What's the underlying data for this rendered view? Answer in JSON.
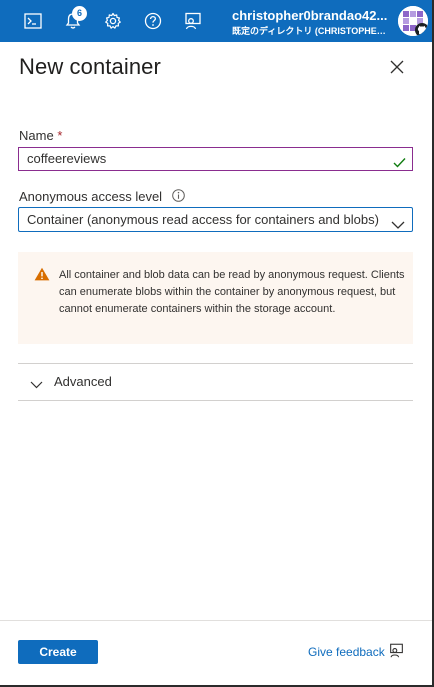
{
  "topbar": {
    "notification_count": "6",
    "account_name": "christopher0brandao42...",
    "directory": "既定のディレクトリ (CHRISTOPHER0..."
  },
  "panel": {
    "title": "New container",
    "name_label": "Name",
    "required_mark": "*",
    "name_value": "coffeereviews",
    "access_label": "Anonymous access level",
    "access_value": "Container (anonymous read access for containers and blobs)",
    "warning_text": "All container and blob data can be read by anonymous request. Clients can enumerate blobs within the container by anonymous request, but cannot enumerate containers within the storage account.",
    "advanced_label": "Advanced"
  },
  "footer": {
    "create_label": "Create",
    "feedback_label": "Give feedback"
  },
  "colors": {
    "topbar": "#0f6cbd",
    "primary": "#0f6cbd",
    "input_border_valid": "#8a2d8f",
    "success_check": "#107c10",
    "warning_icon": "#d86e00",
    "warning_bg": "#fdf6f0"
  },
  "icons": [
    "cloud-shell-icon",
    "bell-icon",
    "gear-icon",
    "help-icon",
    "feedback-icon",
    "avatar",
    "close-icon",
    "check-icon",
    "info-icon",
    "chevron-down-icon",
    "warning-icon",
    "chevron-down-icon"
  ]
}
